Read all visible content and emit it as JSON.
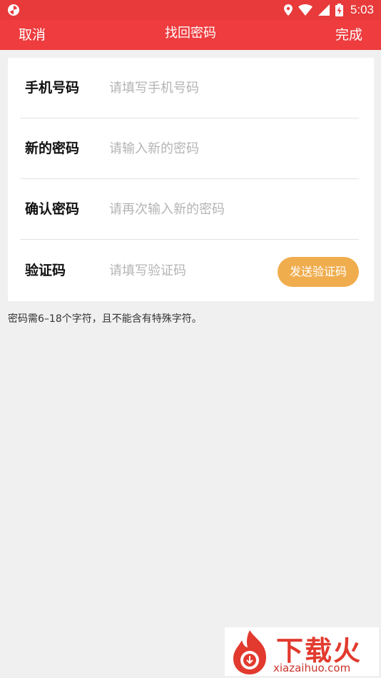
{
  "status_bar": {
    "time": "5:03",
    "icons": [
      "app-logo-icon",
      "location-icon",
      "wifi-icon",
      "signal-icon",
      "battery-charging-icon"
    ]
  },
  "toolbar": {
    "cancel_label": "取消",
    "title": "找回密码",
    "done_label": "完成",
    "color": "#ee3c3f"
  },
  "form": {
    "phone": {
      "label": "手机号码",
      "placeholder": "请填写手机号码",
      "value": ""
    },
    "new_password": {
      "label": "新的密码",
      "placeholder": "请输入新的密码",
      "value": ""
    },
    "confirm_password": {
      "label": "确认密码",
      "placeholder": "请再次输入新的密码",
      "value": ""
    },
    "code": {
      "label": "验证码",
      "placeholder": "请填写验证码",
      "value": "",
      "send_label": "发送验证码"
    }
  },
  "hint": "密码需6–18个字符，且不能含有特殊字符。",
  "watermark": {
    "brand": "下载火",
    "url": "xiazaihuo.com"
  },
  "colors": {
    "accent": "#ee3c3f",
    "button": "#f0ad4e",
    "background": "#f0f0f0"
  }
}
